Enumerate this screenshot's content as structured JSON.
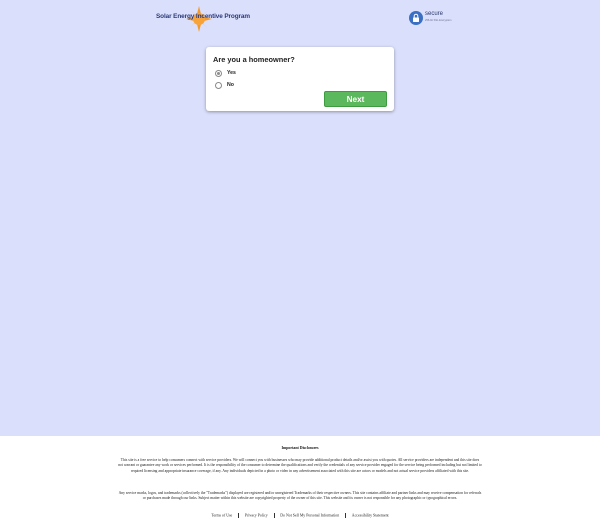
{
  "header": {
    "logo_text": "Solar Energy Incentive Program",
    "secure_label": "secure",
    "secure_sub": "256-bit SSL Encryption"
  },
  "form": {
    "question": "Are you a homeowner?",
    "options": [
      {
        "label": "Yes",
        "selected": true
      },
      {
        "label": "No",
        "selected": false
      }
    ],
    "next_label": "Next"
  },
  "footer": {
    "disclosure_title": "Important Disclosures",
    "paragraph1": "This site is a free service to help consumers connect with service providers. We will connect you with businesses who may provide additional product details and/or assist you with quotes. All service providers are independent and this site does not warrant or guarantee any work or services performed. It is the responsibility of the consumer to determine the qualifications and verify the credentials of any service provider engaged for the service being performed including but not limited to required licensing and appropriate insurance coverage, if any. Any individuals depicted in a photo or video in any advertisement associated with this site are actors or models and not actual service providers affiliated with this site.",
    "paragraph2": "Any service marks, logos, and trademarks (collectively the \"Trademarks\") displayed are registered and/or unregistered Trademarks of their respective owners. This site contains affiliate and partner links and may receive compensation for referrals or purchases made through our links. Subject matter within this website are copyrighted property of the owner of this site. This website and its owner is not responsible for any photographic or typographical errors.",
    "links": [
      "Terms of Use",
      "Privacy Policy",
      "Do Not Sell My Personal Information",
      "Accessibility Statement"
    ]
  },
  "colors": {
    "background": "#dadffb",
    "next_button": "#5cb85c",
    "brand_text": "#2a3a7a"
  }
}
